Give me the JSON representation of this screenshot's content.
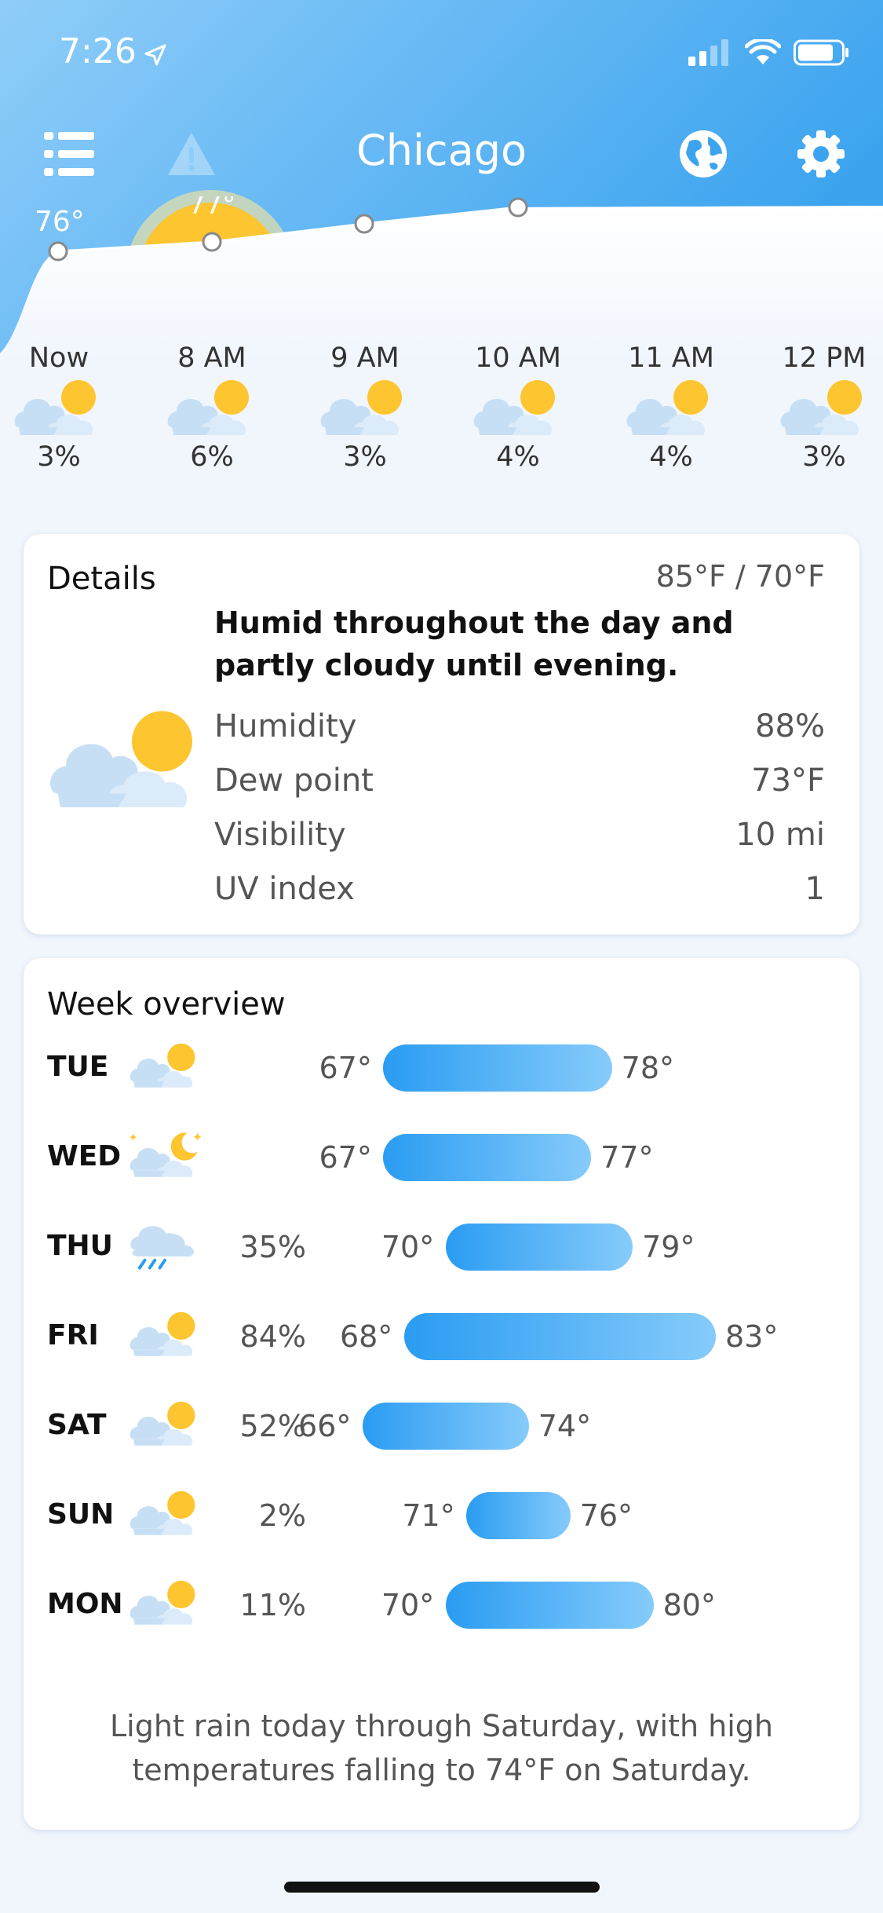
{
  "status": {
    "time": "7:26"
  },
  "header": {
    "city": "Chicago"
  },
  "hourly": [
    {
      "label": "Now",
      "precip": "3%",
      "temp": "76°"
    },
    {
      "label": "8 AM",
      "precip": "6%",
      "temp": "77°"
    },
    {
      "label": "9 AM",
      "precip": "3%"
    },
    {
      "label": "10 AM",
      "precip": "4%"
    },
    {
      "label": "11 AM",
      "precip": "4%"
    },
    {
      "label": "12 PM",
      "precip": "3%"
    }
  ],
  "details": {
    "title": "Details",
    "range": "85°F / 70°F",
    "summary": "Humid throughout the day and partly cloudy until evening.",
    "stats": [
      {
        "label": "Humidity",
        "value": "88%"
      },
      {
        "label": "Dew point",
        "value": "73°F"
      },
      {
        "label": "Visibility",
        "value": "10 mi"
      },
      {
        "label": "UV index",
        "value": "1"
      }
    ]
  },
  "week": {
    "title": "Week overview",
    "temp_scale": {
      "min": 66,
      "max": 83
    },
    "days": [
      {
        "day": "TUE",
        "precip": "",
        "low": "67°",
        "high": "78°",
        "low_val": 67,
        "high_val": 78,
        "icon": "partly-cloudy-icon"
      },
      {
        "day": "WED",
        "precip": "",
        "low": "67°",
        "high": "77°",
        "low_val": 67,
        "high_val": 77,
        "icon": "partly-cloudy-night-icon"
      },
      {
        "day": "THU",
        "precip": "35%",
        "low": "70°",
        "high": "79°",
        "low_val": 70,
        "high_val": 79,
        "icon": "rain-icon"
      },
      {
        "day": "FRI",
        "precip": "84%",
        "low": "68°",
        "high": "83°",
        "low_val": 68,
        "high_val": 83,
        "icon": "partly-cloudy-icon"
      },
      {
        "day": "SAT",
        "precip": "52%",
        "low": "66°",
        "high": "74°",
        "low_val": 66,
        "high_val": 74,
        "icon": "partly-cloudy-icon"
      },
      {
        "day": "SUN",
        "precip": "2%",
        "low": "71°",
        "high": "76°",
        "low_val": 71,
        "high_val": 76,
        "icon": "partly-cloudy-icon"
      },
      {
        "day": "MON",
        "precip": "11%",
        "low": "70°",
        "high": "80°",
        "low_val": 70,
        "high_val": 80,
        "icon": "partly-cloudy-icon"
      }
    ],
    "summary": "Light rain today through Saturday, with high temperatures falling to 74°F on Saturday."
  },
  "colors": {
    "header_top": "#8ecbf8",
    "header_bottom": "#3fa6f0",
    "bar_start": "#2a9cf2",
    "bar_end": "#86cbfb",
    "cloud": "#c7dff5",
    "sun": "#fdc52f"
  }
}
